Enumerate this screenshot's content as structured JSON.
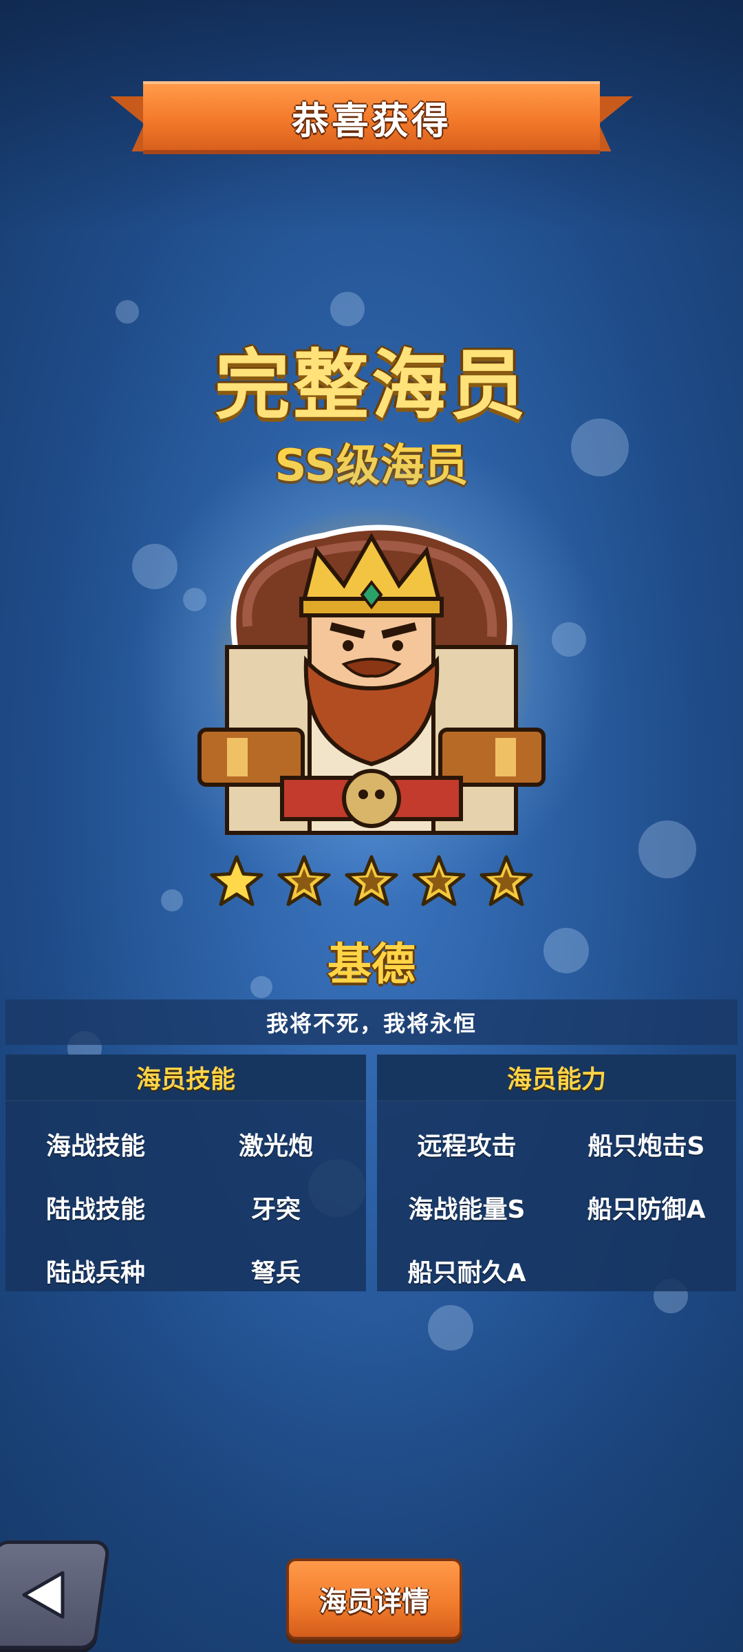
{
  "banner": {
    "title": "恭喜获得"
  },
  "reward": {
    "headline": "完整海员",
    "rank": "SS级海员",
    "star_count": 5,
    "name": "基德",
    "motto": "我将不死，我将永恒"
  },
  "skills_panel": {
    "title": "海员技能",
    "rows": [
      {
        "label": "海战技能",
        "value": "激光炮"
      },
      {
        "label": "陆战技能",
        "value": "牙突"
      },
      {
        "label": "陆战兵种",
        "value": "弩兵"
      }
    ]
  },
  "ability_panel": {
    "title": "海员能力",
    "items": [
      "远程攻击",
      "船只炮击S",
      "海战能量S",
      "船只防御A",
      "船只耐久A"
    ]
  },
  "buttons": {
    "detail_label": "海员详情"
  },
  "colors": {
    "accent_orange": "#f37a2a",
    "gold_text": "#ffd447",
    "panel_bg": "#16345f"
  },
  "icons": [
    "back-arrow-icon",
    "star-icon"
  ]
}
